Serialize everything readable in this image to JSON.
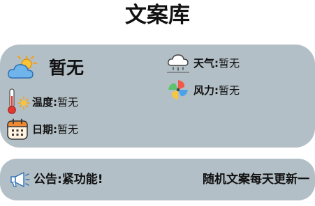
{
  "app": {
    "title": "文案库"
  },
  "weather": {
    "status": "暂无",
    "temperature": {
      "label": "温度",
      "value": "暂无"
    },
    "date": {
      "label": "日期",
      "value": "暂无"
    },
    "condition": {
      "label": "天气",
      "value": "暂无"
    },
    "wind": {
      "label": "风力",
      "value": "暂无"
    },
    "separator": ":"
  },
  "notice": {
    "label": "公告",
    "text": "紧功能!",
    "right_text": "随机文案每天更新一"
  },
  "icons": {
    "status": "sun-behind-cloud-icon",
    "temperature": "thermometer-sun-icon",
    "date": "calendar-icon",
    "condition": "cloud-rain-icon",
    "wind": "pinwheel-icon",
    "notice": "megaphone-icon"
  },
  "colors": {
    "card_background": "#b3bfc6",
    "text": "#111111"
  }
}
